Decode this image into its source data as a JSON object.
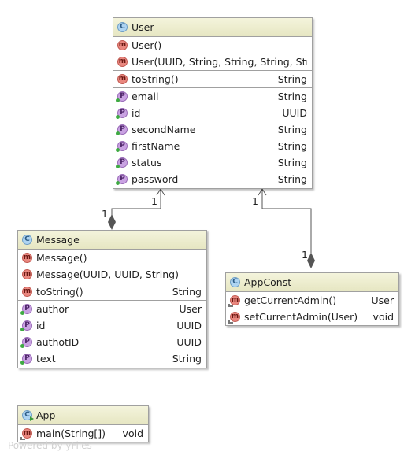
{
  "classes": {
    "user": {
      "icon": "class-icon",
      "name": "User",
      "constructors": [
        {
          "name": "User()",
          "type": ""
        },
        {
          "name": "User(UUID, String, String, String, String)",
          "type": ""
        }
      ],
      "methods": [
        {
          "name": "toString()",
          "type": "String"
        }
      ],
      "properties": [
        {
          "name": "email",
          "type": "String"
        },
        {
          "name": "id",
          "type": "UUID"
        },
        {
          "name": "secondName",
          "type": "String"
        },
        {
          "name": "firstName",
          "type": "String"
        },
        {
          "name": "status",
          "type": "String"
        },
        {
          "name": "password",
          "type": "String"
        }
      ]
    },
    "message": {
      "icon": "class-icon",
      "name": "Message",
      "constructors": [
        {
          "name": "Message()",
          "type": ""
        },
        {
          "name": "Message(UUID, UUID, String)",
          "type": ""
        }
      ],
      "methods": [
        {
          "name": "toString()",
          "type": "String"
        }
      ],
      "properties": [
        {
          "name": "author",
          "type": "User"
        },
        {
          "name": "id",
          "type": "UUID"
        },
        {
          "name": "authotID",
          "type": "UUID"
        },
        {
          "name": "text",
          "type": "String"
        }
      ]
    },
    "appconst": {
      "icon": "class-icon",
      "name": "AppConst",
      "methods": [
        {
          "name": "getCurrentAdmin()",
          "type": "User"
        },
        {
          "name": "setCurrentAdmin(User)",
          "type": "void"
        }
      ]
    },
    "app": {
      "icon": "runnable-class-icon",
      "name": "App",
      "methods": [
        {
          "name": "main(String[])",
          "type": "void"
        }
      ]
    }
  },
  "associations": [
    {
      "from": "Message",
      "to": "User",
      "kind": "composition",
      "target_multiplicity": "1",
      "source_multiplicity": "1"
    },
    {
      "from": "AppConst",
      "to": "User",
      "kind": "composition",
      "target_multiplicity": "1",
      "source_multiplicity": "1"
    }
  ],
  "icon_letters": {
    "class": "C",
    "method": "m",
    "property": "P"
  },
  "colors": {
    "header_top": "#f4f4dc",
    "header_bottom": "#e6e6c2",
    "border": "#a0a0a0",
    "class_icon": "#aed4f2",
    "method_icon": "#e9877f",
    "property_icon": "#c9a2e2",
    "line": "#555555",
    "watermark": "#d2d2d2"
  },
  "watermark": "Powered by yFiles"
}
